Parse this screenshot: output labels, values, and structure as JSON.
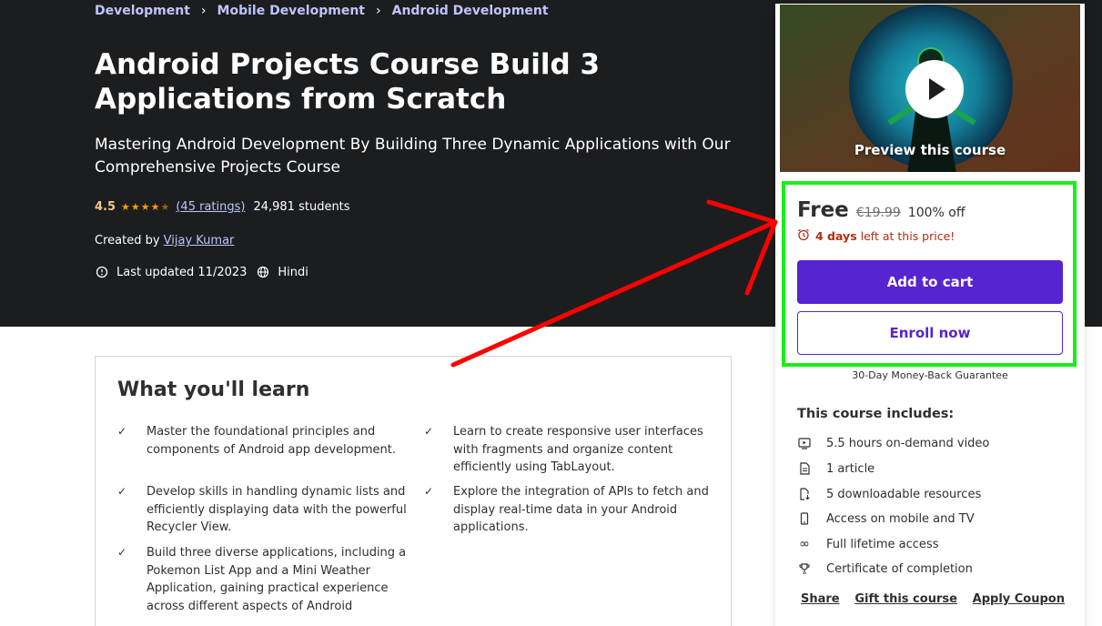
{
  "breadcrumb": [
    "Development",
    "Mobile Development",
    "Android Development"
  ],
  "course": {
    "title": "Android Projects Course Build 3 Applications from Scratch",
    "subtitle": "Mastering Android Development By Building Three Dynamic Applications with Our Comprehensive Projects Course",
    "rating": "4.5",
    "stars_value": 4.5,
    "ratings_count": "(45 ratings)",
    "students": "24,981 students",
    "created_by_label": "Created by",
    "author": "Vijay Kumar",
    "last_updated": "Last updated 11/2023",
    "language": "Hindi"
  },
  "learn": {
    "title": "What you'll learn",
    "items": [
      "Master the foundational principles and components of Android app development.",
      "Learn to create responsive user interfaces with fragments and organize content efficiently using TabLayout.",
      "Develop skills in handling dynamic lists and efficiently displaying data with the powerful Recycler View.",
      "Explore the integration of APIs to fetch and display real-time data in your Android applications.",
      "Build three diverse applications, including a Pokemon List App and a Mini Weather Application, gaining practical experience across different aspects of Android"
    ]
  },
  "sidebar": {
    "preview_label": "Preview this course",
    "price": "Free",
    "original_price": "€19.99",
    "discount": "100% off",
    "timer_days": "4 days",
    "timer_text": "left at this price!",
    "add_to_cart": "Add to cart",
    "enroll_now": "Enroll now",
    "guarantee": "30-Day Money-Back Guarantee",
    "includes_title": "This course includes:",
    "includes": [
      {
        "icon": "video-icon",
        "text": "5.5 hours on-demand video"
      },
      {
        "icon": "article-icon",
        "text": "1 article"
      },
      {
        "icon": "download-file-icon",
        "text": "5 downloadable resources"
      },
      {
        "icon": "mobile-icon",
        "text": "Access on mobile and TV"
      },
      {
        "icon": "infinity-icon",
        "text": "Full lifetime access"
      },
      {
        "icon": "trophy-icon",
        "text": "Certificate of completion"
      }
    ],
    "share": "Share",
    "gift": "Gift this course",
    "coupon": "Apply Coupon"
  },
  "colors": {
    "hero_bg": "#1c1d1f",
    "accent_purple": "#5624d0",
    "link_purple": "#c0c4fc",
    "star_orange": "#f69c08",
    "annotation_red": "#ff0000",
    "annotation_green": "#16f016"
  }
}
